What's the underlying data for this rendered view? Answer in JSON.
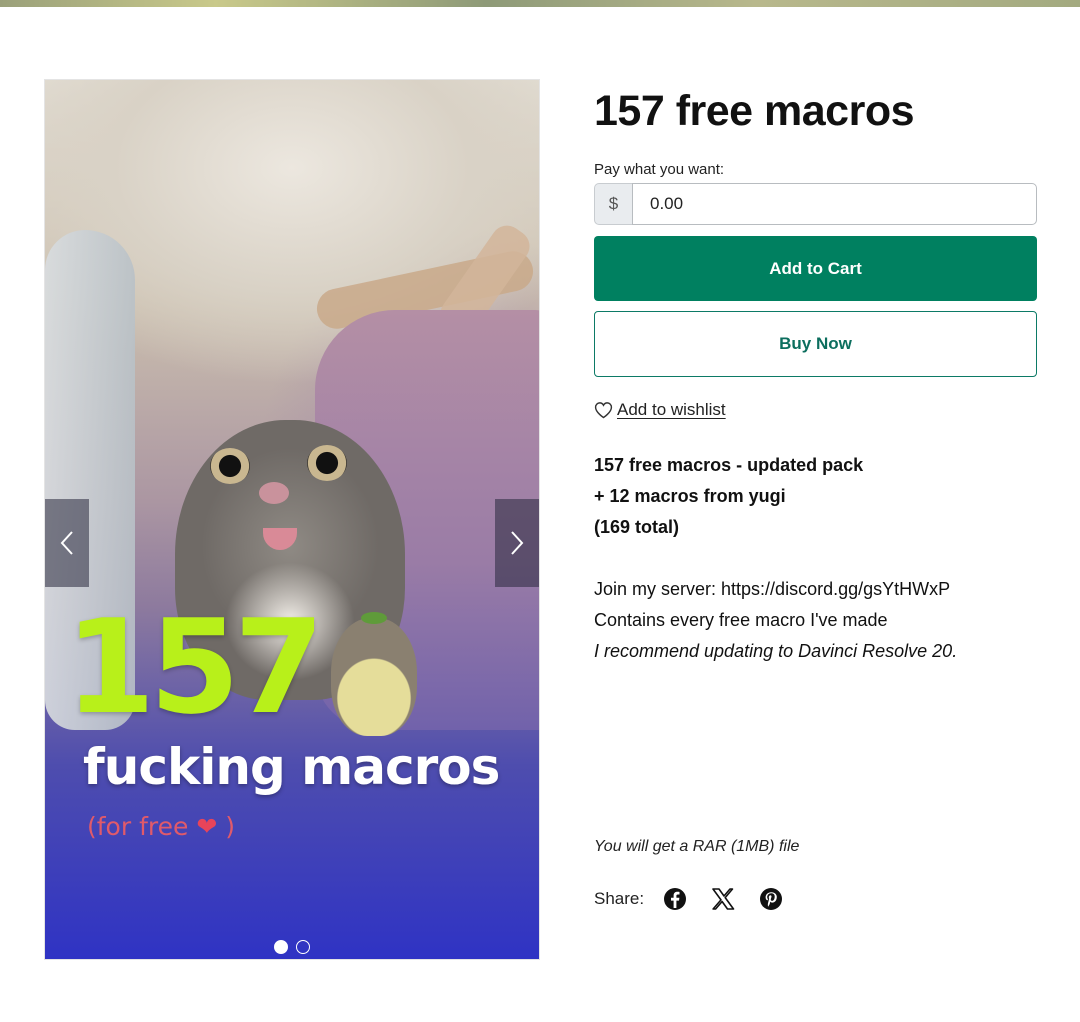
{
  "product": {
    "title": "157 free macros",
    "pay_label": "Pay what you want:",
    "currency_symbol": "$",
    "price_value": "0.00",
    "add_to_cart_label": "Add to Cart",
    "buy_now_label": "Buy Now",
    "wishlist_label": "Add to wishlist",
    "file_note": "You will get a RAR (1MB) file",
    "share_label": "Share:"
  },
  "description": {
    "line1": "157 free macros - updated pack",
    "line2": "+ 12 macros from yugi",
    "line3": "(169 total)",
    "line4": "Join my server: https://discord.gg/gsYtHWxP",
    "line5": "Contains every free macro I've made",
    "line6": "I recommend updating to Davinci Resolve 20."
  },
  "gallery": {
    "image_text_number": "157",
    "image_text_main": "fucking macros",
    "image_text_free": "(for free",
    "image_text_heart": "❤",
    "image_text_close": ")",
    "slide_count": 2,
    "active_slide": 1
  },
  "share_icons": [
    "facebook-icon",
    "x-icon",
    "pinterest-icon"
  ],
  "colors": {
    "primary": "#008060",
    "primary_text": "#0c6e5e",
    "image_number": "#b8f01a"
  }
}
